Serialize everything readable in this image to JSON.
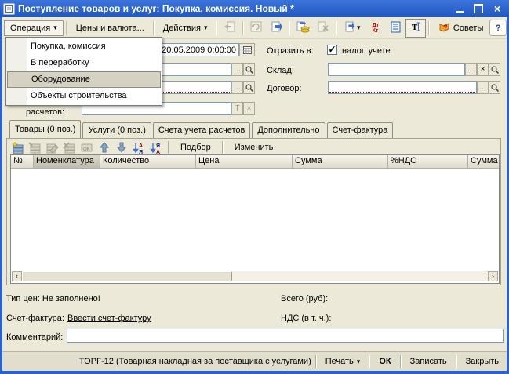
{
  "window": {
    "title": "Поступление товаров и услуг: Покупка, комиссия. Новый *"
  },
  "menubar": {
    "operation_label": "Операция",
    "prices_label": "Цены и валюта...",
    "actions_label": "Действия",
    "tips_label": "Советы",
    "help_label": "?"
  },
  "operation_menu": {
    "items": [
      {
        "label": "Покупка, комиссия",
        "selected": false
      },
      {
        "label": "В переработку",
        "selected": false
      },
      {
        "label": "Оборудование",
        "selected": true
      },
      {
        "label": "Объекты строительства",
        "selected": false
      }
    ]
  },
  "fields": {
    "date_value": "20.05.2009 0:00:00",
    "settlement_label": "расчетов:",
    "reflect_in_label": "Отразить в:",
    "tax_accounting_label": "налог. учете",
    "tax_checked": true,
    "warehouse_label": "Склад:",
    "warehouse_value": "",
    "contract_label": "Договор:",
    "contract_value": ""
  },
  "tabs": {
    "items": [
      {
        "label": "Товары (0 поз.)",
        "active": true
      },
      {
        "label": "Услуги (0 поз.)",
        "active": false
      },
      {
        "label": "Счета учета расчетов",
        "active": false
      },
      {
        "label": "Дополнительно",
        "active": false
      },
      {
        "label": "Счет-фактура",
        "active": false
      }
    ]
  },
  "grid": {
    "buttons": {
      "podbor": "Подбор",
      "izmenit": "Изменить"
    },
    "columns": [
      "№",
      "Номенклатура",
      "Количество",
      "Цена",
      "Сумма",
      "%НДС",
      "Сумма"
    ],
    "rows": []
  },
  "summary": {
    "price_type": "Тип цен: Не заполнено!",
    "invoice_label": "Счет-фактура:",
    "invoice_link": "Ввести счет-фактуру",
    "total_label": "Всего (руб):",
    "vat_label": "НДС (в т. ч.):",
    "comment_label": "Комментарий:"
  },
  "bottom": {
    "torg12": "ТОРГ-12 (Товарная накладная за поставщика с услугами)",
    "print": "Печать",
    "ok": "ОК",
    "save": "Записать",
    "close": "Закрыть"
  },
  "icons": {
    "dropdown_caret": "▾",
    "check": "✓",
    "ellipsis": "...",
    "t_letter": "T",
    "x_letter": "×",
    "left_arrow": "‹",
    "right_arrow": "›",
    "up_arrow": "↑",
    "down_arrow": "↓",
    "dt": "Дт",
    "kt": "Кт"
  },
  "colors": {
    "titlebar": "#2a63cc",
    "background": "#ece9d8",
    "menu_highlight": "#d6d2c3",
    "required_underline": "#cc0000",
    "field_border": "#7f9db9"
  }
}
